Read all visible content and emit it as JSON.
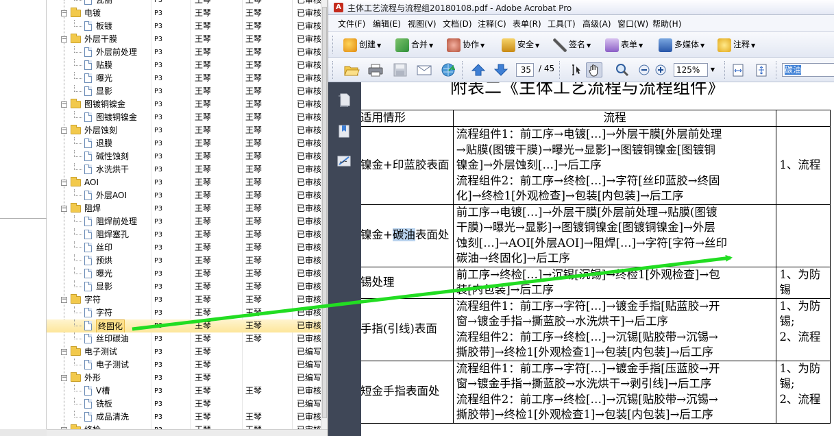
{
  "tree": {
    "rows": [
      {
        "name": "瓦丽",
        "level": "P3",
        "owner1": "王琴",
        "owner2": "王琴",
        "status": "已审核",
        "kind": "doc",
        "indent": 1,
        "partial": true
      },
      {
        "name": "电镀",
        "level": "P3",
        "owner1": "王琴",
        "owner2": "王琴",
        "status": "已审核",
        "kind": "folder",
        "indent": 0
      },
      {
        "name": "板镀",
        "level": "P3",
        "owner1": "王琴",
        "owner2": "王琴",
        "status": "已审核",
        "kind": "doc",
        "indent": 1
      },
      {
        "name": "外层干膜",
        "level": "P3",
        "owner1": "王琴",
        "owner2": "王琴",
        "status": "已审核",
        "kind": "folder",
        "indent": 0
      },
      {
        "name": "外层前处理",
        "level": "P3",
        "owner1": "王琴",
        "owner2": "王琴",
        "status": "已审核",
        "kind": "doc",
        "indent": 1
      },
      {
        "name": "贴膜",
        "level": "P3",
        "owner1": "王琴",
        "owner2": "王琴",
        "status": "已审核",
        "kind": "doc",
        "indent": 1
      },
      {
        "name": "曝光",
        "level": "P3",
        "owner1": "王琴",
        "owner2": "王琴",
        "status": "已审核",
        "kind": "doc",
        "indent": 1
      },
      {
        "name": "显影",
        "level": "P3",
        "owner1": "王琴",
        "owner2": "王琴",
        "status": "已审核",
        "kind": "doc",
        "indent": 1
      },
      {
        "name": "图镀铜镍金",
        "level": "P3",
        "owner1": "王琴",
        "owner2": "王琴",
        "status": "已审核",
        "kind": "folder",
        "indent": 0
      },
      {
        "name": "图镀铜镍金",
        "level": "P3",
        "owner1": "王琴",
        "owner2": "王琴",
        "status": "已审核",
        "kind": "doc",
        "indent": 1
      },
      {
        "name": "外层蚀刻",
        "level": "P3",
        "owner1": "王琴",
        "owner2": "王琴",
        "status": "已审核",
        "kind": "folder",
        "indent": 0
      },
      {
        "name": "退膜",
        "level": "P3",
        "owner1": "王琴",
        "owner2": "王琴",
        "status": "已审核",
        "kind": "doc",
        "indent": 1
      },
      {
        "name": "碱性蚀刻",
        "level": "P3",
        "owner1": "王琴",
        "owner2": "王琴",
        "status": "已审核",
        "kind": "doc",
        "indent": 1
      },
      {
        "name": "水洗烘干",
        "level": "P3",
        "owner1": "王琴",
        "owner2": "王琴",
        "status": "已审核",
        "kind": "doc",
        "indent": 1
      },
      {
        "name": "AOI",
        "level": "P3",
        "owner1": "王琴",
        "owner2": "王琴",
        "status": "已审核",
        "kind": "folder",
        "indent": 0
      },
      {
        "name": "外层AOI",
        "level": "P3",
        "owner1": "王琴",
        "owner2": "王琴",
        "status": "已审核",
        "kind": "doc",
        "indent": 1
      },
      {
        "name": "阻焊",
        "level": "P3",
        "owner1": "王琴",
        "owner2": "王琴",
        "status": "已审核",
        "kind": "folder",
        "indent": 0
      },
      {
        "name": "阻焊前处理",
        "level": "P3",
        "owner1": "王琴",
        "owner2": "王琴",
        "status": "已审核",
        "kind": "doc",
        "indent": 1
      },
      {
        "name": "阻焊塞孔",
        "level": "P3",
        "owner1": "王琴",
        "owner2": "王琴",
        "status": "已审核",
        "kind": "doc",
        "indent": 1
      },
      {
        "name": "丝印",
        "level": "P3",
        "owner1": "王琴",
        "owner2": "王琴",
        "status": "已审核",
        "kind": "doc",
        "indent": 1
      },
      {
        "name": "预烘",
        "level": "P3",
        "owner1": "王琴",
        "owner2": "王琴",
        "status": "已审核",
        "kind": "doc",
        "indent": 1
      },
      {
        "name": "曝光",
        "level": "P3",
        "owner1": "王琴",
        "owner2": "王琴",
        "status": "已审核",
        "kind": "doc",
        "indent": 1
      },
      {
        "name": "显影",
        "level": "P3",
        "owner1": "王琴",
        "owner2": "王琴",
        "status": "已审核",
        "kind": "doc",
        "indent": 1
      },
      {
        "name": "字符",
        "level": "P3",
        "owner1": "王琴",
        "owner2": "王琴",
        "status": "已审核",
        "kind": "folder",
        "indent": 0
      },
      {
        "name": "字符",
        "level": "P3",
        "owner1": "王琴",
        "owner2": "王琴",
        "status": "已审核",
        "kind": "doc",
        "indent": 1
      },
      {
        "name": "终固化",
        "level": "P3",
        "owner1": "王琴",
        "owner2": "王琴",
        "status": "已审核",
        "kind": "doc",
        "indent": 1,
        "selected": true
      },
      {
        "name": "丝印碳油",
        "level": "P3",
        "owner1": "王琴",
        "owner2": "王琴",
        "status": "已审核",
        "kind": "doc",
        "indent": 1
      },
      {
        "name": "电子测试",
        "level": "P3",
        "owner1": "王琴",
        "owner2": "",
        "status": "已编写",
        "kind": "folder",
        "indent": 0
      },
      {
        "name": "电子测试",
        "level": "P3",
        "owner1": "王琴",
        "owner2": "",
        "status": "已编写",
        "kind": "doc",
        "indent": 1
      },
      {
        "name": "外形",
        "level": "P3",
        "owner1": "王琴",
        "owner2": "",
        "status": "已编写",
        "kind": "folder",
        "indent": 0
      },
      {
        "name": "V槽",
        "level": "P3",
        "owner1": "王琴",
        "owner2": "王琴",
        "status": "已审核",
        "kind": "doc",
        "indent": 1
      },
      {
        "name": "铣板",
        "level": "P3",
        "owner1": "王琴",
        "owner2": "",
        "status": "已编写",
        "kind": "doc",
        "indent": 1
      },
      {
        "name": "成品清洗",
        "level": "P3",
        "owner1": "王琴",
        "owner2": "王琴",
        "status": "已审核",
        "kind": "doc",
        "indent": 1
      },
      {
        "name": "终检",
        "level": "P3",
        "owner1": "王琴",
        "owner2": "王琴",
        "status": "已审核",
        "kind": "folder",
        "indent": 0
      }
    ]
  },
  "acrobat": {
    "title": "主体工艺流程与流程组20180108.pdf - Adobe Acrobat Pro",
    "menus": [
      "文件(F)",
      "编辑(E)",
      "视图(V)",
      "文档(D)",
      "注释(C)",
      "表单(R)",
      "工具(T)",
      "高级(A)",
      "窗口(W)",
      "帮助(H)"
    ],
    "toolbar": {
      "create": "创建",
      "combine": "合并",
      "collaborate": "协作",
      "security": "安全",
      "sign": "签名",
      "forms": "表单",
      "multimedia": "多媒体",
      "comment": "注释"
    },
    "page_current": "35",
    "page_total": "/ 45",
    "zoom": "125%",
    "find_text": "碳油",
    "colors": {
      "accent": "#2a63c4",
      "arrow": "#22dd22",
      "selection": "#fde08a"
    }
  },
  "document": {
    "title": "附表二《主体工艺流程与流程组件》",
    "headers": [
      "适用情形",
      "流程",
      ""
    ],
    "rows": [
      {
        "case": "镍金+印蓝胶表面",
        "flow": [
          "流程组件1：前工序→电镀[…]→外层干膜[外层前处理",
          "→贴膜(图镀干膜)→曝光→显影]→图镀铜镍金[图镀铜",
          "镍金]→外层蚀刻[…]→后工序",
          "流程组件2：前工序→终检[…]→字符[丝印蓝胶→终固",
          "化]→终检1[外观检查]→包装[内包装]→后工序"
        ],
        "note": [
          "",
          "",
          "1、流程",
          "",
          ""
        ]
      },
      {
        "case_pre": "镍金+",
        "case_hl": "碳油",
        "case_post": "表面处",
        "flow": [
          "前工序→电镀[…]→外层干膜[外层前处理→贴膜(图镀",
          "干膜)→曝光→显影]→图镀铜镍金[图镀铜镍金]→外层",
          "蚀刻[…]→AOI[外层AOI]→阻焊[…]→字符[字符→丝印",
          "碳油→终固化]→后工序"
        ],
        "note": [
          "",
          "",
          "",
          ""
        ]
      },
      {
        "case": "锡处理",
        "flow": [
          "前工序→终检[…]→沉锡[沉锡]→终检1[外观检查]→包",
          "装[内包装]→后工序"
        ],
        "note": [
          "1、为防",
          "锡"
        ]
      },
      {
        "case": "手指(引线)表面",
        "flow": [
          "流程组件1：前工序→字符[…]→镀金手指[贴蓝胶→开",
          "窗→镀金手指→撕蓝胶→水洗烘干]→后工序",
          "流程组件2：前工序→终检[…]→沉锡[贴胶带→沉锡→",
          "撕胶带]→终检1[外观检查1]→包装[内包装]→后工序"
        ],
        "note": [
          "1、为防",
          "锡;",
          "2、流程",
          ""
        ]
      },
      {
        "case": "短金手指表面处",
        "flow": [
          "流程组件1：前工序→字符[…]→镀金手指[压蓝胶→开",
          "窗→镀金手指→撕蓝胶→水洗烘干→剥引线]→后工序",
          "流程组件2：前工序→终检[…]→沉锡[贴胶带→沉锡→",
          "撕胶带]→终检1[外观检查1]→包装[内包装]→后工序"
        ],
        "note": [
          "1、为防",
          "锡;",
          "2、流程",
          ""
        ]
      }
    ]
  }
}
